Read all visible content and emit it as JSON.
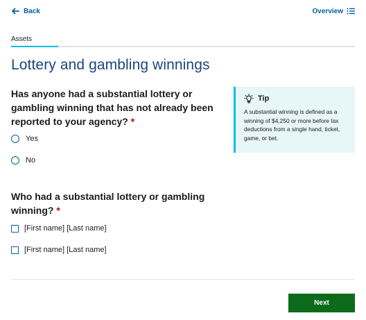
{
  "nav": {
    "back_label": "Back",
    "overview_label": "Overview"
  },
  "section": {
    "label": "Assets"
  },
  "page": {
    "title": "Lottery and gambling winnings"
  },
  "question1": {
    "text": "Has anyone had a substantial lottery or gambling winning that has not already been reported to your agency?",
    "required_mark": "*",
    "options": [
      "Yes",
      "No"
    ]
  },
  "question2": {
    "text": "Who had a substantial lottery or gambling winning?",
    "required_mark": "*",
    "options": [
      "[First name] [Last name]",
      "[First name] [Last name]"
    ]
  },
  "tip": {
    "title": "Tip",
    "body": "A substantial winning is defined as a winning of $4,250 or more before tax deductions from a single hand, ticket, game, or bet."
  },
  "actions": {
    "next_label": "Next"
  },
  "colors": {
    "link": "#005ea2",
    "title": "#1a4480",
    "accent": "#00bde3",
    "tip_bg": "#e7f6f8",
    "required": "#b50909",
    "next_button": "#0b6b1b"
  }
}
